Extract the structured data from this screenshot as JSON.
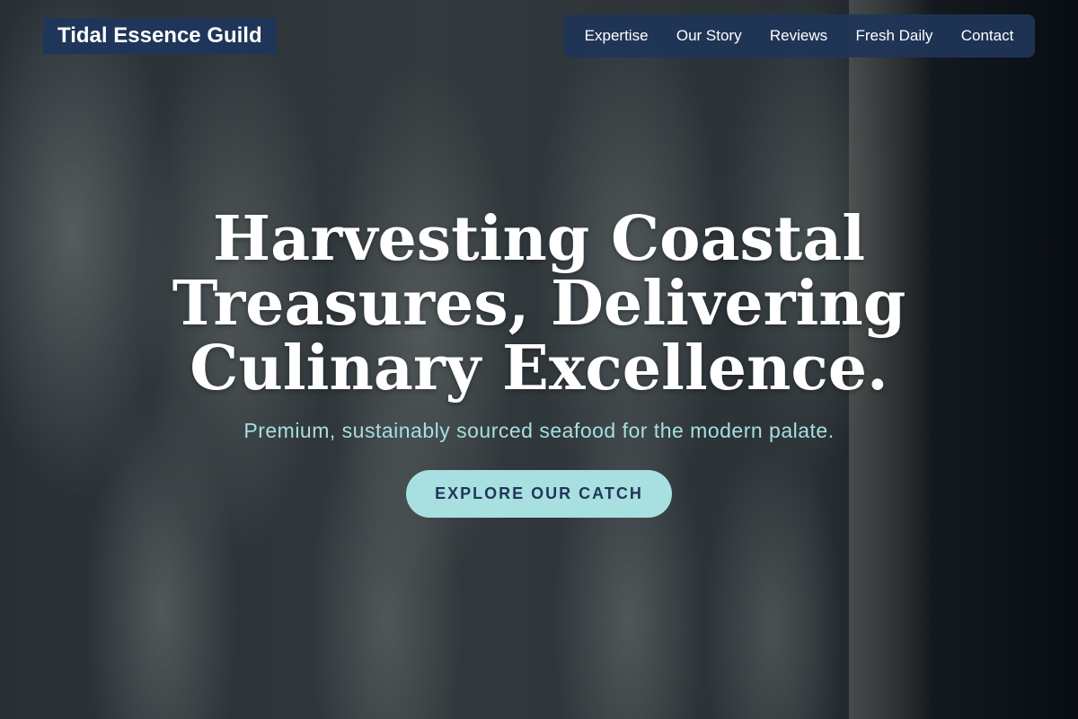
{
  "brand": {
    "name": "Tidal Essence Guild"
  },
  "nav": {
    "items": [
      {
        "label": "Expertise"
      },
      {
        "label": "Our Story"
      },
      {
        "label": "Reviews"
      },
      {
        "label": "Fresh Daily"
      },
      {
        "label": "Contact"
      }
    ]
  },
  "hero": {
    "headline": "Harvesting Coastal Treasures, Delivering Culinary Excellence.",
    "subheadline": "Premium, sustainably sourced seafood for the modern palate.",
    "cta_label": "EXPLORE OUR CATCH",
    "background_image": "fresh-fish-crate-photo"
  },
  "colors": {
    "navy": "#1f3559",
    "aqua": "#a8dfe0",
    "white": "#ffffff"
  }
}
